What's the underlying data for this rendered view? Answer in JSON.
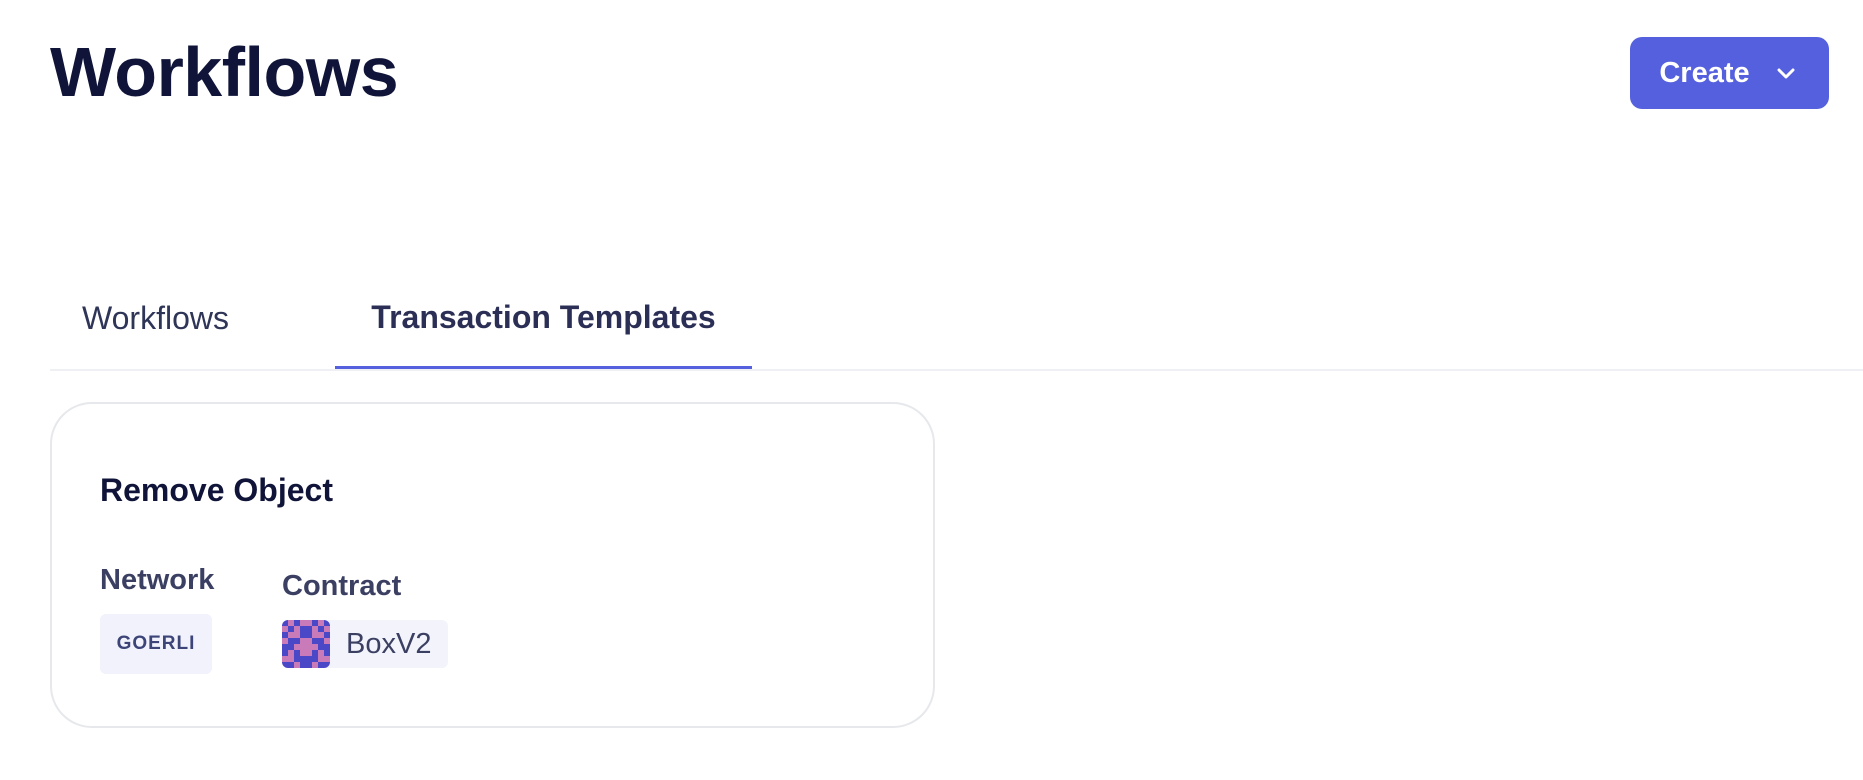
{
  "header": {
    "title": "Workflows",
    "create_label": "Create",
    "create_icon": "chevron-down-icon"
  },
  "tabs": [
    {
      "label": "Workflows",
      "active": false
    },
    {
      "label": "Transaction Templates",
      "active": true
    }
  ],
  "colors": {
    "accent": "#5460dd",
    "title": "#0f1438",
    "muted_text": "#3b4063",
    "badge_bg": "#f1f2fb",
    "card_border": "#e6e8ec"
  },
  "templates": [
    {
      "title": "Remove Object",
      "network_label": "Network",
      "network": "GOERLI",
      "contract_label": "Contract",
      "contract": "BoxV2",
      "contract_icon": "contract-identicon"
    }
  ]
}
